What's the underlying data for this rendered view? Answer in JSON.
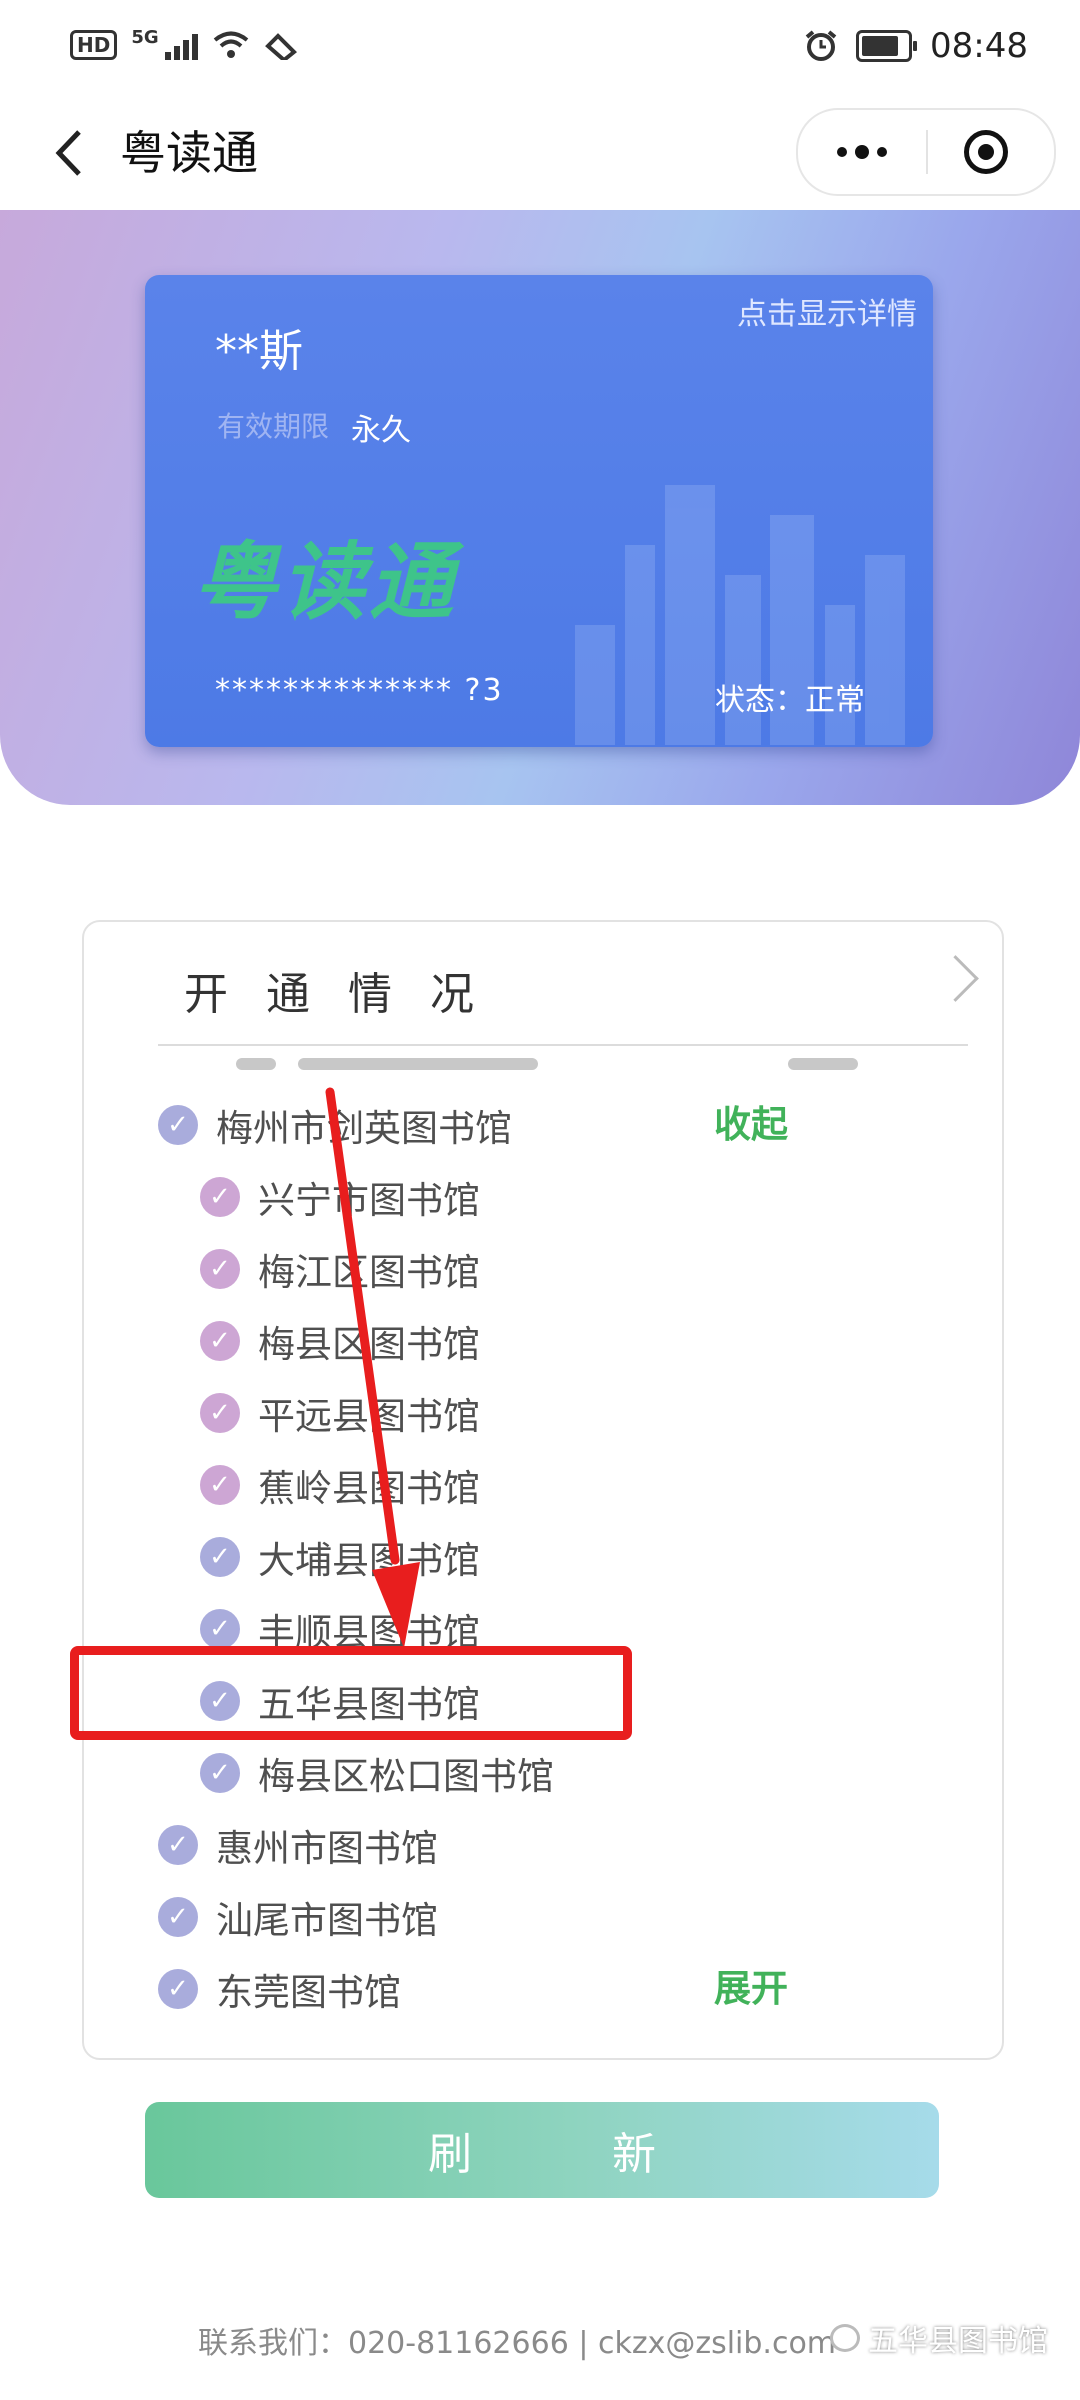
{
  "status_bar": {
    "network": "HD",
    "signal_type": "5G",
    "time": "08:48"
  },
  "nav": {
    "title": "粤读通"
  },
  "card": {
    "name": "**斯",
    "details_link": "点击显示详情",
    "validity_label": "有效期限",
    "validity_value": "永久",
    "logo": "粤读通",
    "number": "************** ?3",
    "status": "状态：正常"
  },
  "panel": {
    "title": "开通情况",
    "libraries": [
      {
        "label": "梅州市剑英图书馆",
        "action": "收起"
      },
      {
        "label": "兴宁市图书馆"
      },
      {
        "label": "梅江区图书馆"
      },
      {
        "label": "梅县区图书馆"
      },
      {
        "label": "平远县图书馆"
      },
      {
        "label": "蕉岭县图书馆"
      },
      {
        "label": "大埔县图书馆"
      },
      {
        "label": "丰顺县图书馆"
      },
      {
        "label": "五华县图书馆"
      },
      {
        "label": "梅县区松口图书馆"
      },
      {
        "label": "惠州市图书馆"
      },
      {
        "label": "汕尾市图书馆"
      },
      {
        "label": "东莞图书馆",
        "action": "展开"
      }
    ]
  },
  "refresh_button": "刷新",
  "footer": {
    "contact": "联系我们：020-81162666 | ckzx@zslib.com",
    "watermark": "五华县图书馆"
  },
  "colors": {
    "accent_green": "#41b25a",
    "highlight_red": "#e81e1e",
    "card_blue": "#4d7ae6"
  }
}
